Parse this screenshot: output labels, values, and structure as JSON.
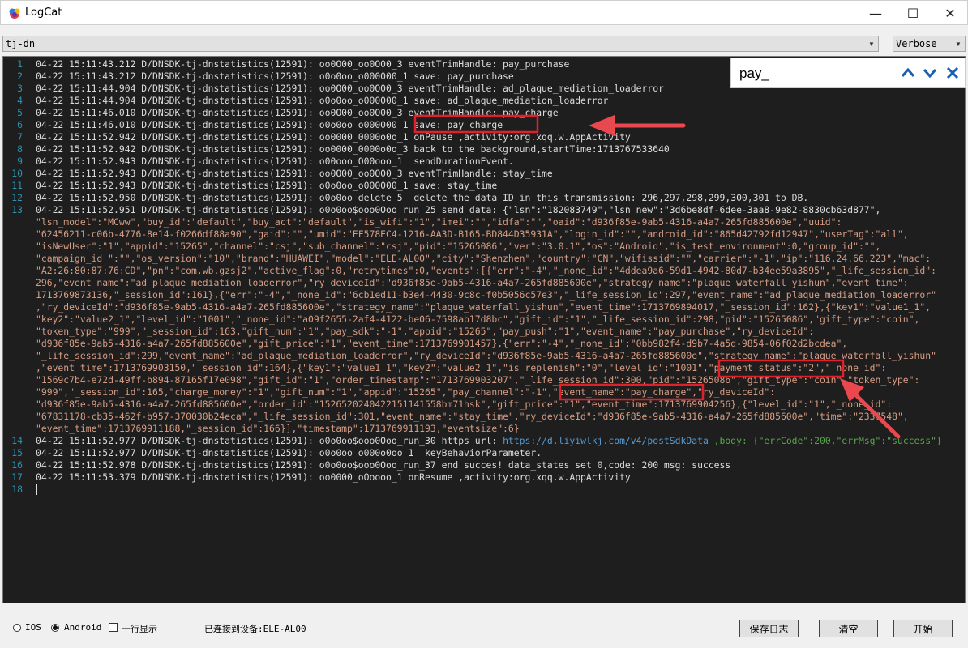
{
  "window": {
    "title": "LogCat",
    "minimize_glyph": "—",
    "maximize_glyph": "☐",
    "close_glyph": "✕",
    "icon": "logcat-app-icon"
  },
  "toolbar": {
    "filter_value": "tj-dn",
    "level_value": "Verbose",
    "dropdown_glyph": "▼"
  },
  "find": {
    "query": "pay_",
    "prev_icon": "chevron-up-icon",
    "next_icon": "chevron-down-icon",
    "close_icon": "close-icon"
  },
  "log": {
    "line_numbers": [
      "1",
      "2",
      "3",
      "4",
      "5",
      "6",
      "7",
      "8",
      "9",
      "10",
      "11",
      "12",
      "13",
      "14",
      "15",
      "16",
      "17",
      "18"
    ],
    "lines": [
      "04-22 15:11:43.212 D/DNSDK-tj-dnstatistics(12591): oo0O00_oo0O00_3 eventTrimHandle: pay_purchase",
      "04-22 15:11:43.212 D/DNSDK-tj-dnstatistics(12591): o0o0oo_o000000_1 save: pay_purchase",
      "04-22 15:11:44.904 D/DNSDK-tj-dnstatistics(12591): oo0O00_oo0O00_3 eventTrimHandle: ad_plaque_mediation_loaderror",
      "04-22 15:11:44.904 D/DNSDK-tj-dnstatistics(12591): o0o0oo_o000000_1 save: ad_plaque_mediation_loaderror",
      "04-22 15:11:46.010 D/DNSDK-tj-dnstatistics(12591): oo0O00_oo0O00_3 eventTrimHandle: pay_charge",
      "04-22 15:11:46.010 D/DNSDK-tj-dnstatistics(12591): o0o0oo_o000000_1 save: pay_charge",
      "04-22 15:11:52.942 D/DNSDK-tj-dnstatistics(12591): oo0000_0000o0o_1 onPause ,activity:org.xqq.w.AppActivity",
      "04-22 15:11:52.942 D/DNSDK-tj-dnstatistics(12591): oo0000_0000o0o_3 back to the background,startTime:1713767533640",
      "04-22 15:11:52.943 D/DNSDK-tj-dnstatistics(12591): o00ooo_O00ooo_1  sendDurationEvent.",
      "04-22 15:11:52.943 D/DNSDK-tj-dnstatistics(12591): oo0O00_oo0O00_3 eventTrimHandle: stay_time",
      "04-22 15:11:52.943 D/DNSDK-tj-dnstatistics(12591): o0o0oo_o000000_1 save: stay_time",
      "04-22 15:11:52.950 D/DNSDK-tj-dnstatistics(12591): o0o0oo_delete_5  delete the data ID in this transmission: 296,297,298,299,300,301 to DB.",
      "04-22 15:11:52.951 D/DNSDK-tj-dnstatistics(12591): o0o0oo$ooo0Ooo_run_25 send data: {\"lsn\":\"182083749\",\"lsn_new\":\"3d6be8df-6dee-3aa8-9e82-8830cb63d877\","
    ],
    "continuation": [
      "\"lsn_model\":\"MCww\",\"buy_id\":\"default\",\"buy_act\":\"default\",\"is_wifi\":\"1\",\"imei\":\"\",\"idfa\":\"\",\"oaid\":\"d936f85e-9ab5-4316-a4a7-265fd885600e\",\"uuid\":",
      "\"62456211-c06b-4776-8e14-f0266df88a90\",\"gaid\":\"\",\"umid\":\"EF578EC4-1216-AA3D-B165-BD844D35931A\",\"login_id\":\"\",\"android_id\":\"865d42792fd12947\",\"userTag\":\"all\",",
      "\"isNewUser\":\"1\",\"appid\":\"15265\",\"channel\":\"csj\",\"sub_channel\":\"csj\",\"pid\":\"15265086\",\"ver\":\"3.0.1\",\"os\":\"Android\",\"is_test_environment\":0,\"group_id\":\"\",",
      "\"campaign_id \":\"\",\"os_version\":\"10\",\"brand\":\"HUAWEI\",\"model\":\"ELE-AL00\",\"city\":\"Shenzhen\",\"country\":\"CN\",\"wifissid\":\"\",\"carrier\":\"-1\",\"ip\":\"116.24.66.223\",\"mac\":",
      "\"A2:26:80:87:76:CD\",\"pn\":\"com.wb.gzsj2\",\"active_flag\":0,\"retrytimes\":0,\"events\":[{\"err\":\"-4\",\"_none_id\":\"4ddea9a6-59d1-4942-80d7-b34ee59a3895\",\"_life_session_id\":",
      "296,\"event_name\":\"ad_plaque_mediation_loaderror\",\"ry_deviceId\":\"d936f85e-9ab5-4316-a4a7-265fd885600e\",\"strategy_name\":\"plaque_waterfall_yishun\",\"event_time\":",
      "1713769873136,\"_session_id\":161},{\"err\":\"-4\",\"_none_id\":\"6cb1ed11-b3e4-4430-9c8c-f0b5056c57e3\",\"_life_session_id\":297,\"event_name\":\"ad_plaque_mediation_loaderror\"",
      ",\"ry_deviceId\":\"d936f85e-9ab5-4316-a4a7-265fd885600e\",\"strategy_name\":\"plaque_waterfall_yishun\",\"event_time\":1713769894017,\"_session_id\":162},{\"key1\":\"value1_1\",",
      "\"key2\":\"value2_1\",\"level_id\":\"1001\",\"_none_id\":\"a09f2655-2af4-4122-be06-7598ab17d8bc\",\"gift_id\":\"1\",\"_life_session_id\":298,\"pid\":\"15265086\",\"gift_type\":\"coin\",",
      "\"token_type\":\"999\",\"_session_id\":163,\"gift_num\":\"1\",\"pay_sdk\":\"-1\",\"appid\":\"15265\",\"pay_push\":\"1\",\"event_name\":\"pay_purchase\",\"ry_deviceId\":",
      "\"d936f85e-9ab5-4316-a4a7-265fd885600e\",\"gift_price\":\"1\",\"event_time\":1713769901457},{\"err\":\"-4\",\"_none_id\":\"0bb982f4-d9b7-4a5d-9854-06f02d2bcdea\",",
      "\"_life_session_id\":299,\"event_name\":\"ad_plaque_mediation_loaderror\",\"ry_deviceId\":\"d936f85e-9ab5-4316-a4a7-265fd885600e\",\"strategy_name\":\"plaque_waterfall_yishun\"",
      ",\"event_time\":1713769903150,\"_session_id\":164},{\"key1\":\"value1_1\",\"key2\":\"value2_1\",\"is_replenish\":\"0\",\"level_id\":\"1001\",\"payment_status\":\"2\",\"_none_id\":",
      "\"1569c7b4-e72d-49ff-b894-87165f17e098\",\"gift_id\":\"1\",\"order_timestamp\":\"1713769903207\",\"_life_session_id\":300,\"pid\":\"15265086\",\"gift_type\":\"coin\",\"token_type\":",
      "\"999\",\"_session_id\":165,\"charge_money\":\"1\",\"gift_num\":\"1\",\"appid\":\"15265\",\"pay_channel\":\"-1\",\"event_name\":\"pay_charge\",\"ry_deviceId\":",
      "\"d936f85e-9ab5-4316-a4a7-265fd885600e\",\"order_id\":\"1526520240422151141558bm71hsk\",\"gift_price\":\"1\",\"event_time\":1713769904256},{\"level_id\":\"1\",\"_none_id\":",
      "\"67831178-cb35-462f-b957-370030b24eca\",\"_life_session_id\":301,\"event_name\":\"stay_time\",\"ry_deviceId\":\"d936f85e-9ab5-4316-a4a7-265fd885600e\",\"time\":\"2337548\",",
      "\"event_time\":1713769911188,\"_session_id\":166}],\"timestamp\":1713769911193,\"eventsize\":6}"
    ],
    "line14_prefix": "04-22 15:11:52.977 D/DNSDK-tj-dnstatistics(12591): o0o0oo$ooo0Ooo_run_30 https url: ",
    "line14_url": "https://d.liyiwlkj.com/v4/postSdkData",
    "line14_body": " ,body: {\"errCode\":200,\"errMsg\":\"success\"}",
    "tail_lines": [
      "04-22 15:11:52.977 D/DNSDK-tj-dnstatistics(12591): o0o0oo_o000o0oo_1  keyBehaviorParameter.",
      "04-22 15:11:52.978 D/DNSDK-tj-dnstatistics(12591): o0o0oo$ooo0Ooo_run_37 end succes! data_states set 0,code: 200 msg: success",
      "04-22 15:11:53.379 D/DNSDK-tj-dnstatistics(12591): oo0000_oOoooo_1 onResume ,activity:org.xqq.w.AppActivity"
    ]
  },
  "annotations": {
    "highlight_color": "#e0202a",
    "arrow_color": "#e8484e"
  },
  "bottom": {
    "radio_ios": "IOS",
    "radio_android": "Android",
    "checkbox_label": "一行显示",
    "status": "已连接到设备:ELE-AL00",
    "save_log": "保存日志",
    "clear": "清空",
    "start": "开始"
  }
}
